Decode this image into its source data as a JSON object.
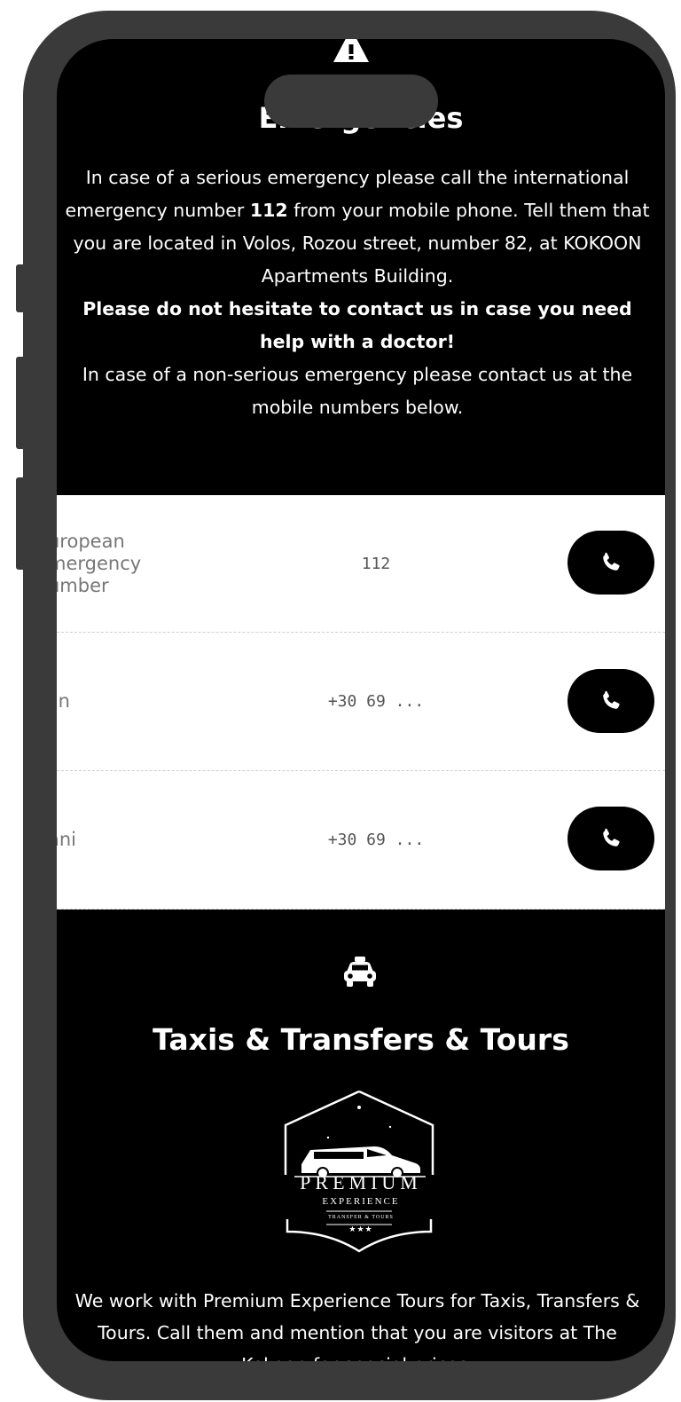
{
  "emergencies": {
    "icon": "warning-icon",
    "title": "Emergencies",
    "p1_before": "In case of a serious emergency please call the international emergency number ",
    "p1_number": "112",
    "p1_after": " from your mobile phone. Tell them that you are located in Volos, Rozou street, number 82, at KOKOON Apartments Building.",
    "p2_bold": "Please do not hesitate to contact us in case you need help with a doctor!",
    "p3": "In case of a non-serious emergency please contact us at the mobile numbers below."
  },
  "contacts": [
    {
      "name": "uropean\nmergency\number",
      "number": "112",
      "call_icon": "phone-icon"
    },
    {
      "name": "lin",
      "number": "+30 69 ...",
      "call_icon": "phone-icon"
    },
    {
      "name": "ani",
      "number": "+30 69 ...",
      "call_icon": "phone-icon"
    }
  ],
  "taxis": {
    "icon": "car-icon",
    "title": "Taxis & Transfers & Tours",
    "logo": {
      "line1": "PREMIUM",
      "line2": "EXPERIENCE",
      "line3": "TRANSFER & TOURS",
      "stars": "★★★"
    },
    "text": "We work with Premium Experience Tours for Taxis, Transfers & Tours. Call them and mention that you are visitors at The Kokoon for special prices."
  },
  "colors": {
    "background": "#000000",
    "frame": "#3a3a3a",
    "rows": "#ffffff"
  }
}
